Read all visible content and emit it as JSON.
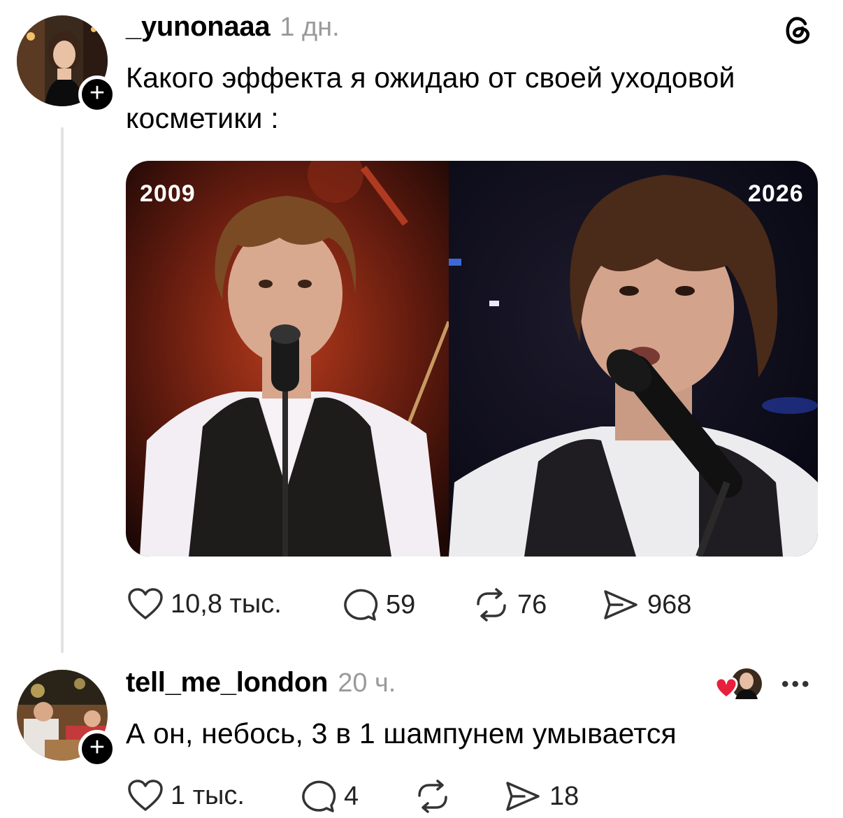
{
  "post": {
    "username": "_yunonaaa",
    "time": "1 дн.",
    "text": "Какого эффекта я ожидаю от своей уходовой косметики :",
    "image": {
      "left_label": "2009",
      "right_label": "2026"
    },
    "actions": {
      "likes": "10,8 тыс.",
      "comments": "59",
      "reposts": "76",
      "shares": "968"
    },
    "icons": [
      "heart-icon",
      "comment-icon",
      "repost-icon",
      "share-icon",
      "threads-logo-icon"
    ]
  },
  "reply": {
    "username": "tell_me_london",
    "time": "20 ч.",
    "text": "А он, небось, 3 в 1 шампунем умывается",
    "actions": {
      "likes": "1 тыс.",
      "comments": "4",
      "reposts": "",
      "shares": "18"
    },
    "more": "•••"
  },
  "colors": {
    "heart_red": "#e8203b",
    "muted": "#9a9a9a",
    "thread_line": "#e2e2e2"
  }
}
